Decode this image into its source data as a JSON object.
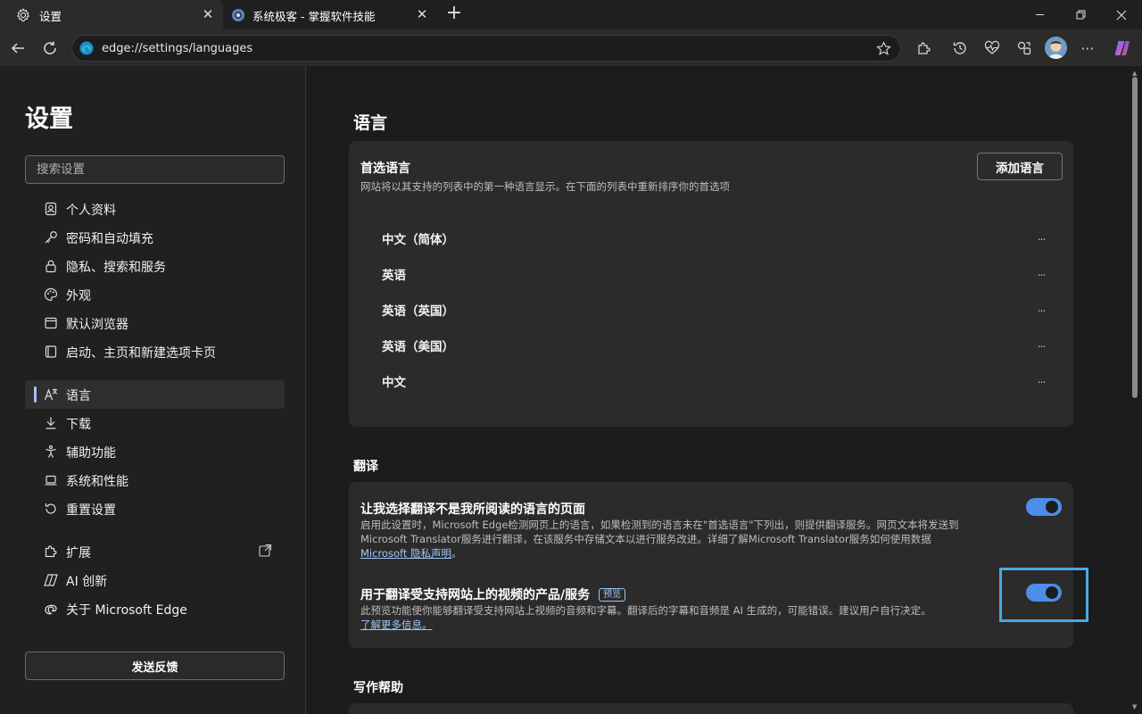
{
  "tabs": [
    {
      "title": "设置",
      "icon": "gear-icon",
      "active": true
    },
    {
      "title": "系统极客 - 掌握软件技能",
      "icon": "site-favicon-icon",
      "active": false
    }
  ],
  "toolbar": {
    "url": "edge://settings/languages"
  },
  "sidebar": {
    "title": "设置",
    "search_placeholder": "搜索设置",
    "items": [
      {
        "label": "个人资料",
        "icon": "profile-icon"
      },
      {
        "label": "密码和自动填充",
        "icon": "key-icon"
      },
      {
        "label": "隐私、搜索和服务",
        "icon": "lock-icon"
      },
      {
        "label": "外观",
        "icon": "palette-icon"
      },
      {
        "label": "默认浏览器",
        "icon": "browser-window-icon"
      },
      {
        "label": "启动、主页和新建选项卡页",
        "icon": "startup-icon"
      },
      {
        "label": "语言",
        "icon": "language-icon",
        "active": true
      },
      {
        "label": "下载",
        "icon": "download-icon"
      },
      {
        "label": "辅助功能",
        "icon": "accessibility-icon"
      },
      {
        "label": "系统和性能",
        "icon": "laptop-icon"
      },
      {
        "label": "重置设置",
        "icon": "reset-icon"
      },
      {
        "label": "扩展",
        "icon": "puzzle-icon"
      },
      {
        "label": "AI 创新",
        "icon": "ai-icon"
      },
      {
        "label": "关于 Microsoft Edge",
        "icon": "edge-logo-icon"
      }
    ],
    "feedback_label": "发送反馈"
  },
  "main": {
    "heading": "语言",
    "preferred": {
      "title": "首选语言",
      "description": "网站将以其支持的列表中的第一种语言显示。在下面的列表中重新排序你的首选项",
      "add_button": "添加语言",
      "languages": [
        "中文（简体）",
        "英语",
        "英语（英国）",
        "英语（美国）",
        "中文"
      ],
      "more_label": "..."
    },
    "translate": {
      "heading": "翻译",
      "offer": {
        "title": "让我选择翻译不是我所阅读的语言的页面",
        "description": "启用此设置时，Microsoft Edge检测网页上的语言，如果检测到的语言未在\"首选语言\"下列出，则提供翻译服务。网页文本将发送到Microsoft Translator服务进行翻译，在该服务中存储文本以进行服务改进。详细了解Microsoft Translator服务如何使用数据",
        "link": "Microsoft 隐私声明",
        "link_suffix": "。",
        "enabled": true
      },
      "video": {
        "title": "用于翻译受支持网站上的视频的产品/服务",
        "badge": "预览",
        "description": "此预览功能使你能够翻译受支持网站上视频的音频和字幕。翻译后的字幕和音频是 AI 生成的，可能错误。建议用户自行决定。",
        "link": "了解更多信息。",
        "enabled": true
      }
    },
    "writing": {
      "heading": "写作帮助"
    }
  },
  "colors": {
    "accent": "#4c8ee8",
    "link": "#9ec7f7",
    "focus": "#4ca8e0"
  }
}
